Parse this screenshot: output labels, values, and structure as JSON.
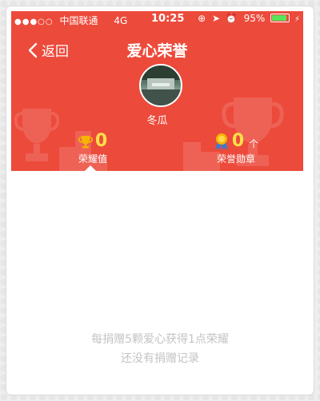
{
  "status_bar": {
    "signal": "●●●○○",
    "carrier": "中国联通",
    "network": "4G",
    "time": "10:25",
    "battery": "95%"
  },
  "nav": {
    "back_label": "返回",
    "title": "爱心荣誉"
  },
  "profile": {
    "username": "冬瓜"
  },
  "stats": {
    "honor_value": "0",
    "honor_label": "荣耀值",
    "badges_value": "0",
    "badges_unit": "个",
    "badges_label": "荣誉勋章"
  },
  "empty_state": {
    "line1": "每捐赠5颗爱心获得1点荣耀",
    "line2": "还没有捐赠记录"
  },
  "colors": {
    "header_bg": "#ec4a3b",
    "stat_value": "#ffe04a",
    "empty_text": "#c3c3c3"
  }
}
